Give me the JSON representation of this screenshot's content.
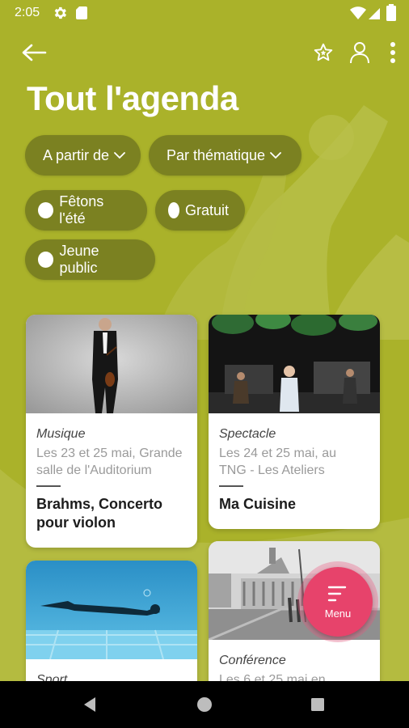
{
  "status_bar": {
    "time": "2:05",
    "icons": [
      "gear-icon",
      "sim-card-icon",
      "wifi-icon",
      "signal-icon",
      "battery-icon"
    ]
  },
  "app_bar": {
    "icons": [
      "arrow-left-icon",
      "star-icon",
      "user-icon",
      "more-vertical-icon"
    ]
  },
  "page": {
    "title": "Tout l'agenda"
  },
  "filters": {
    "dropdowns": [
      {
        "label": "A partir de",
        "icon": "chevron-down-icon"
      },
      {
        "label": "Par thématique",
        "icon": "chevron-down-icon"
      }
    ],
    "toggles": [
      {
        "label": "Fêtons l'été",
        "selected": false
      },
      {
        "label": "Gratuit",
        "selected": false
      },
      {
        "label": "Jeune public",
        "selected": false
      }
    ]
  },
  "events": [
    {
      "category": "Musique",
      "details": [
        "Les 23 et 25 mai, Grande",
        "salle de l'Auditorium"
      ],
      "title_lines": [
        "Brahms, Concerto",
        "pour violon"
      ]
    },
    {
      "category": "Spectacle",
      "details": [
        "Les 24 et 25 mai, au",
        "TNG - Les Ateliers"
      ],
      "title_lines": [
        "Ma Cuisine"
      ]
    },
    {
      "category": "Sport",
      "details": [],
      "title_lines": []
    },
    {
      "category": "Conférence",
      "details": [
        "Les 6 et 25 mai en"
      ],
      "title_lines": []
    }
  ],
  "menu_button": {
    "label": "Menu",
    "icon": "menu-icon"
  },
  "nav_bar": {
    "icons": [
      "nav-back-icon",
      "nav-home-icon",
      "nav-recents-icon"
    ]
  },
  "colors": {
    "background": "#aab22a",
    "chip": "#7b8121",
    "fab": "#e7436b",
    "card": "#ffffff"
  }
}
